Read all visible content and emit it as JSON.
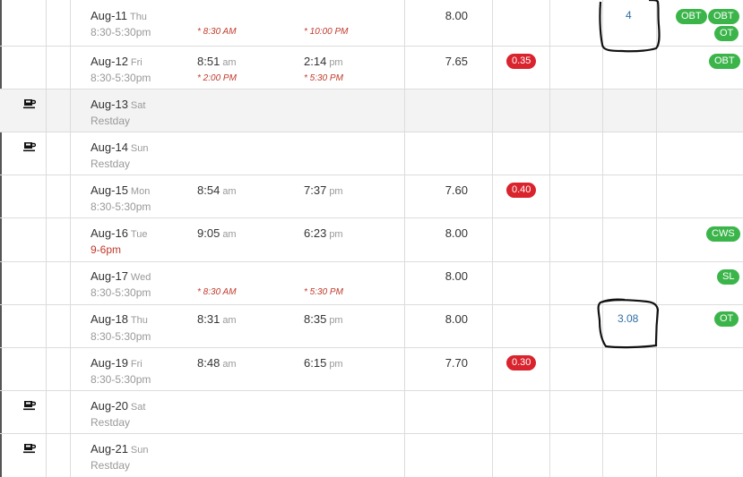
{
  "rows": [
    {
      "date": "Aug-11",
      "dow": "Thu",
      "sched": "8:30-5:30pm",
      "in_req": "* 8:30 AM",
      "out_req": "* 10:00 PM",
      "hours": "8.00",
      "ot": "4",
      "badges": [
        "OBT",
        "OBT",
        "OT"
      ]
    },
    {
      "date": "Aug-12",
      "dow": "Fri",
      "sched": "8:30-5:30pm",
      "in_time": "8:51",
      "in_ampm": "am",
      "out_time": "2:14",
      "out_ampm": "pm",
      "in_req": "* 2:00 PM",
      "out_req": "* 5:30 PM",
      "hours": "7.65",
      "late": "0.35",
      "badges": [
        "OBT"
      ]
    },
    {
      "date": "Aug-13",
      "dow": "Sat",
      "sched": "Restday",
      "restday": true
    },
    {
      "date": "Aug-14",
      "dow": "Sun",
      "sched": "Restday",
      "restday": true
    },
    {
      "date": "Aug-15",
      "dow": "Mon",
      "sched": "8:30-5:30pm",
      "in_time": "8:54",
      "in_ampm": "am",
      "out_time": "7:37",
      "out_ampm": "pm",
      "hours": "7.60",
      "late": "0.40"
    },
    {
      "date": "Aug-16",
      "dow": "Tue",
      "sched": "9-6pm",
      "in_time": "9:05",
      "in_ampm": "am",
      "out_time": "6:23",
      "out_ampm": "pm",
      "hours": "8.00",
      "badges": [
        "CWS"
      ]
    },
    {
      "date": "Aug-17",
      "dow": "Wed",
      "sched": "8:30-5:30pm",
      "in_req": "* 8:30 AM",
      "out_req": "* 5:30 PM",
      "hours": "8.00",
      "badges": [
        "SL"
      ]
    },
    {
      "date": "Aug-18",
      "dow": "Thu",
      "sched": "8:30-5:30pm",
      "in_time": "8:31",
      "in_ampm": "am",
      "out_time": "8:35",
      "out_ampm": "pm",
      "hours": "8.00",
      "ot": "3.08",
      "badges": [
        "OT"
      ]
    },
    {
      "date": "Aug-19",
      "dow": "Fri",
      "sched": "8:30-5:30pm",
      "in_time": "8:48",
      "in_ampm": "am",
      "out_time": "6:15",
      "out_ampm": "pm",
      "hours": "7.70",
      "late": "0.30"
    },
    {
      "date": "Aug-20",
      "dow": "Sat",
      "sched": "Restday",
      "restday": true
    },
    {
      "date": "Aug-21",
      "dow": "Sun",
      "sched": "Restday",
      "restday": true
    }
  ],
  "colors": {
    "late_badge": "#d9232d",
    "status_pill": "#3bb54a",
    "ot_link": "#2f6da3",
    "schedule_red": "#c0392b"
  },
  "icons": {
    "restday": "coffee-cup-icon"
  }
}
